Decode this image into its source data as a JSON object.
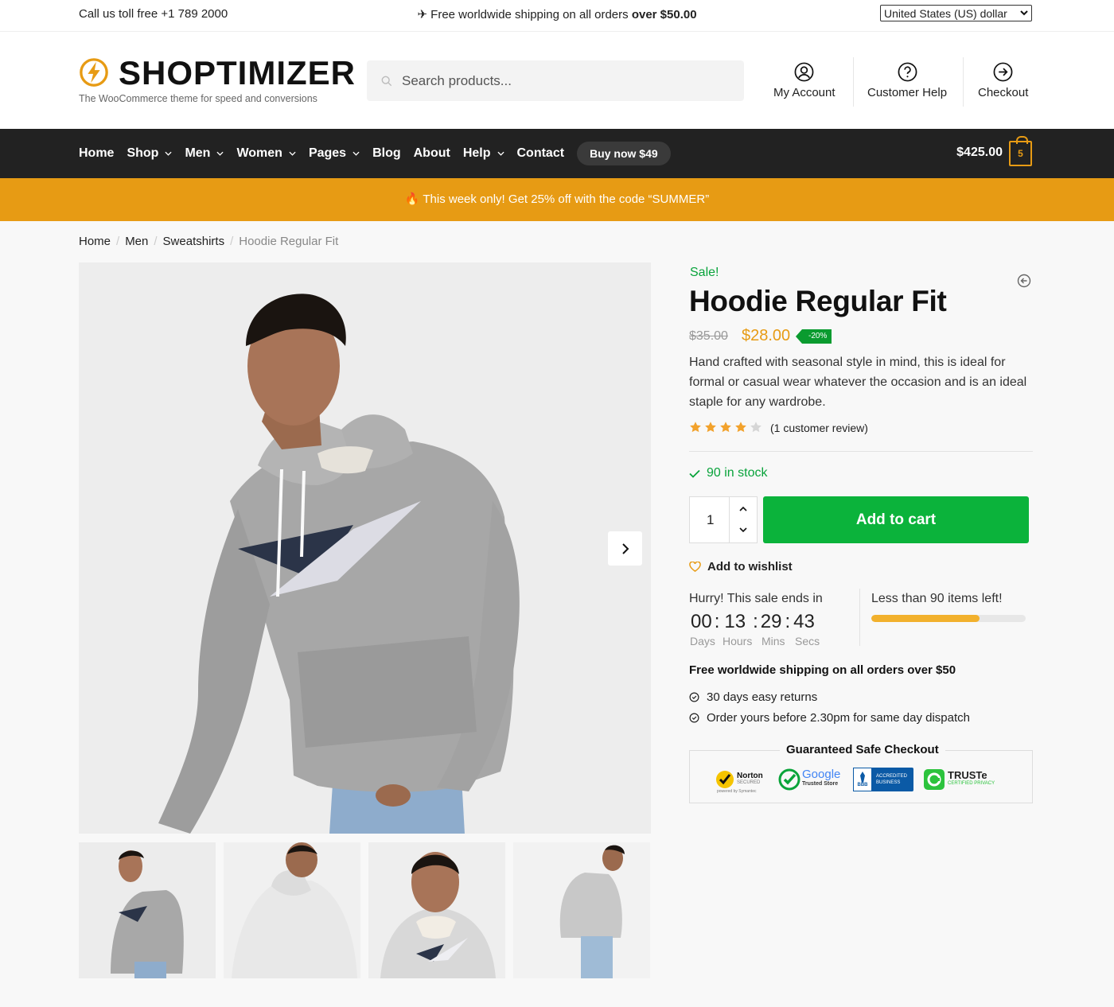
{
  "topbar": {
    "phone": "Call us toll free +1 789 2000",
    "shipping_prefix": "✈ Free worldwide shipping on all orders ",
    "shipping_bold": "over $50.00",
    "currency": "United States (US) dollar"
  },
  "header": {
    "logo_name": "SHOPTIMIZER",
    "logo_tagline": "The WooCommerce theme for speed and conversions",
    "search_placeholder": "Search products...",
    "links": [
      "My Account",
      "Customer Help",
      "Checkout"
    ]
  },
  "nav": {
    "items": [
      "Home",
      "Shop",
      "Men",
      "Women",
      "Pages",
      "Blog",
      "About",
      "Help",
      "Contact"
    ],
    "buy_label": "Buy now $49",
    "cart_total": "$425.00",
    "cart_count": "5"
  },
  "promo": {
    "text": "🔥 This week only! Get 25% off with the code “SUMMER”"
  },
  "breadcrumb": [
    "Home",
    "Men",
    "Sweatshirts",
    "Hoodie Regular Fit"
  ],
  "product": {
    "sale_label": "Sale!",
    "title": "Hoodie Regular Fit",
    "price_old": "$35.00",
    "price_new": "$28.00",
    "discount": "-20%",
    "description": "Hand crafted with seasonal style in mind, this is ideal for formal or casual wear whatever the occasion and is an ideal staple for any wardrobe.",
    "rating": 4,
    "rating_max": 5,
    "review_text": "(1 customer review)",
    "stock": "90 in stock",
    "quantity": "1",
    "add_to_cart": "Add to cart",
    "wishlist": "Add to wishlist"
  },
  "countdown": {
    "label": "Hurry! This sale ends in",
    "days": "00",
    "hours": "13",
    "mins": "29",
    "secs": "43",
    "days_label": "Days",
    "hours_label": "Hours",
    "mins_label": "Mins",
    "secs_label": "Secs"
  },
  "scarcity": {
    "label": "Less than 90 items left!",
    "progress": 0.7
  },
  "shipping": {
    "title": "Free worldwide shipping on all orders over $50",
    "features": [
      "30 days easy returns",
      "Order yours before 2.30pm for same day dispatch"
    ]
  },
  "trust": {
    "title": "Guaranteed Safe Checkout",
    "norton": "Norton",
    "norton_sub": "SECURED",
    "norton_powered": "powered by Symantec",
    "google": "Google",
    "google_sub": "Trusted Store",
    "bbb_line1": "ACCREDITED",
    "bbb_line2": "BUSINESS",
    "bbb_logo": "BBB",
    "truste": "TRUSTe",
    "truste_sub": "CERTIFIED PRIVACY"
  },
  "colors": {
    "accent": "#e79b14",
    "green": "#0bb33b",
    "nav_bg": "#222222"
  }
}
